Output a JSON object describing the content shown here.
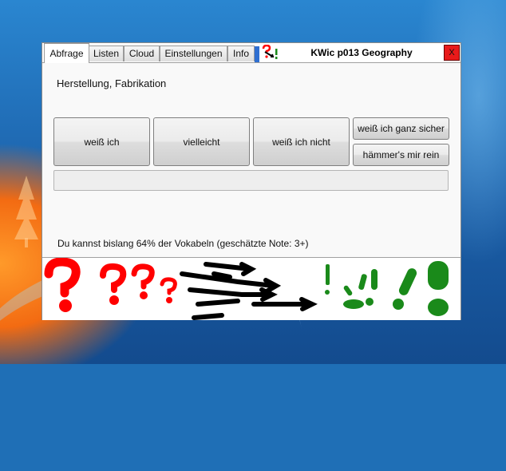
{
  "window": {
    "title": "KWic p013 Geography",
    "close_label": "X",
    "tabs": [
      {
        "label": "Abfrage",
        "active": true
      },
      {
        "label": "Listen",
        "active": false
      },
      {
        "label": "Cloud",
        "active": false
      },
      {
        "label": "Einstellungen",
        "active": false
      },
      {
        "label": "Info",
        "active": false
      }
    ],
    "app_icon": "question-arrow-exclamation-icon"
  },
  "quiz": {
    "question": "Herstellung, Fabrikation",
    "buttons": {
      "know": "weiß ich",
      "maybe": "vielleicht",
      "dont_know": "weiß ich nicht",
      "know_sure": "weiß ich ganz sicher",
      "skip": "hämmer's mir rein"
    },
    "answer_value": "",
    "status": "Du kannst bislang 64% der Vokabeln (geschätzte Note: 3+)"
  },
  "colors": {
    "question_marks": "#ff0000",
    "arrows": "#000000",
    "exclamation_marks": "#1a8a1a",
    "close_button": "#e81a1a"
  }
}
